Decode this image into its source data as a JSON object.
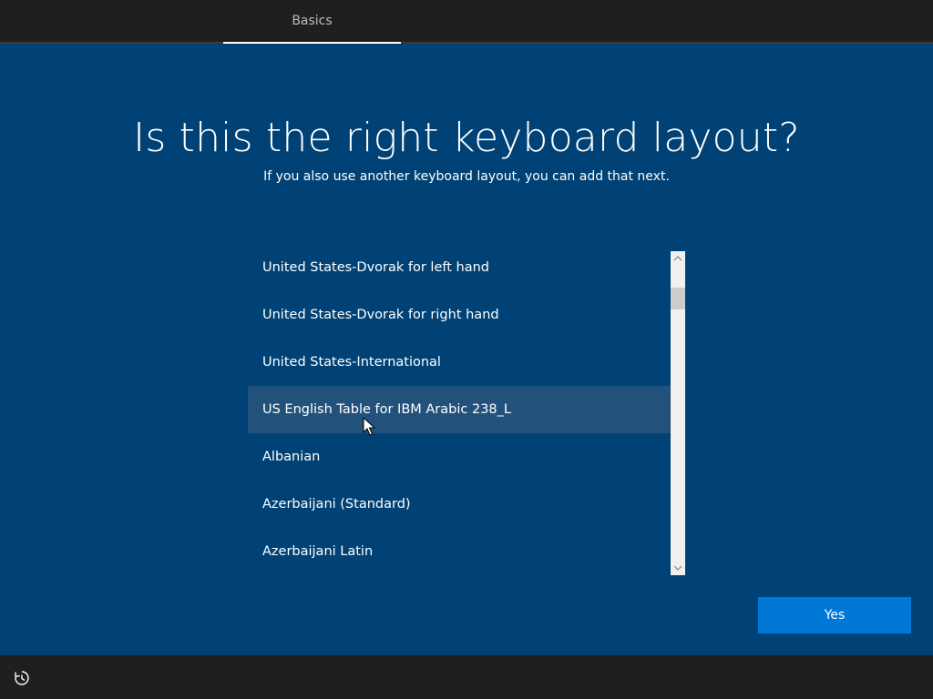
{
  "header": {
    "tab_label": "Basics"
  },
  "main": {
    "title": "Is this the right keyboard layout?",
    "subtitle": "If you also use another keyboard layout, you can add that next."
  },
  "layout_list": {
    "items": [
      {
        "label": "United States-Dvorak for left hand",
        "selected": false
      },
      {
        "label": "United States-Dvorak for right hand",
        "selected": false
      },
      {
        "label": "United States-International",
        "selected": false
      },
      {
        "label": "US English Table for IBM Arabic 238_L",
        "selected": true
      },
      {
        "label": "Albanian",
        "selected": false
      },
      {
        "label": "Azerbaijani (Standard)",
        "selected": false
      },
      {
        "label": "Azerbaijani Latin",
        "selected": false
      }
    ]
  },
  "actions": {
    "yes_label": "Yes"
  },
  "icons": {
    "accessibility": "ease-of-access-icon",
    "scroll_up": "chevron-up-icon",
    "scroll_down": "chevron-down-icon",
    "cursor": "mouse-pointer-icon"
  },
  "colors": {
    "background": "#004275",
    "selected_row": "#22527c",
    "accent_button": "#0078d7",
    "bar": "#1f1f1f"
  }
}
